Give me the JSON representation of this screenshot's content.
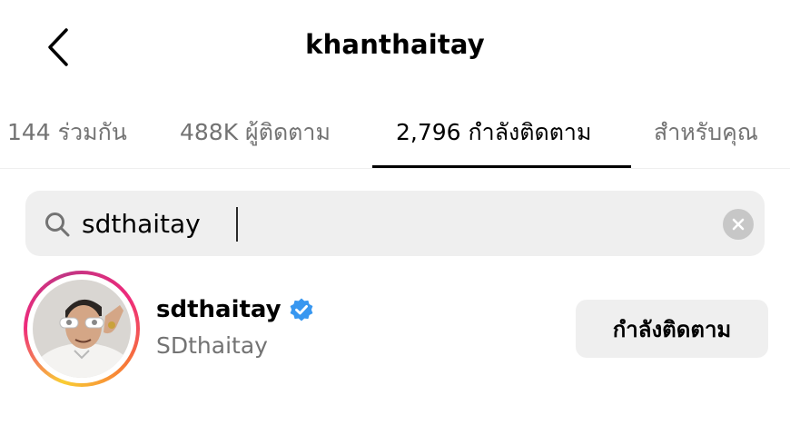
{
  "header": {
    "title": "khanthaitay"
  },
  "tabs": [
    {
      "label": "144 ร่วมกัน"
    },
    {
      "label": "488K ผู้ติดตาม"
    },
    {
      "label": "2,796 กำลังติดตาม"
    },
    {
      "label": "สำหรับคุณ"
    }
  ],
  "active_tab": "2,796 กำลังติดตาม",
  "search": {
    "value": "sdthaitay"
  },
  "results": [
    {
      "username": "sdthaitay",
      "full_name": "SDthaitay",
      "verified": true,
      "button_label": "กำลังติดตาม"
    }
  ],
  "colors": {
    "secondary_text": "#737373",
    "search_bg": "#efefef",
    "verified_blue": "#3897f0",
    "story_ring": [
      "#f9ce34",
      "#ee2a7b",
      "#c13584"
    ]
  }
}
